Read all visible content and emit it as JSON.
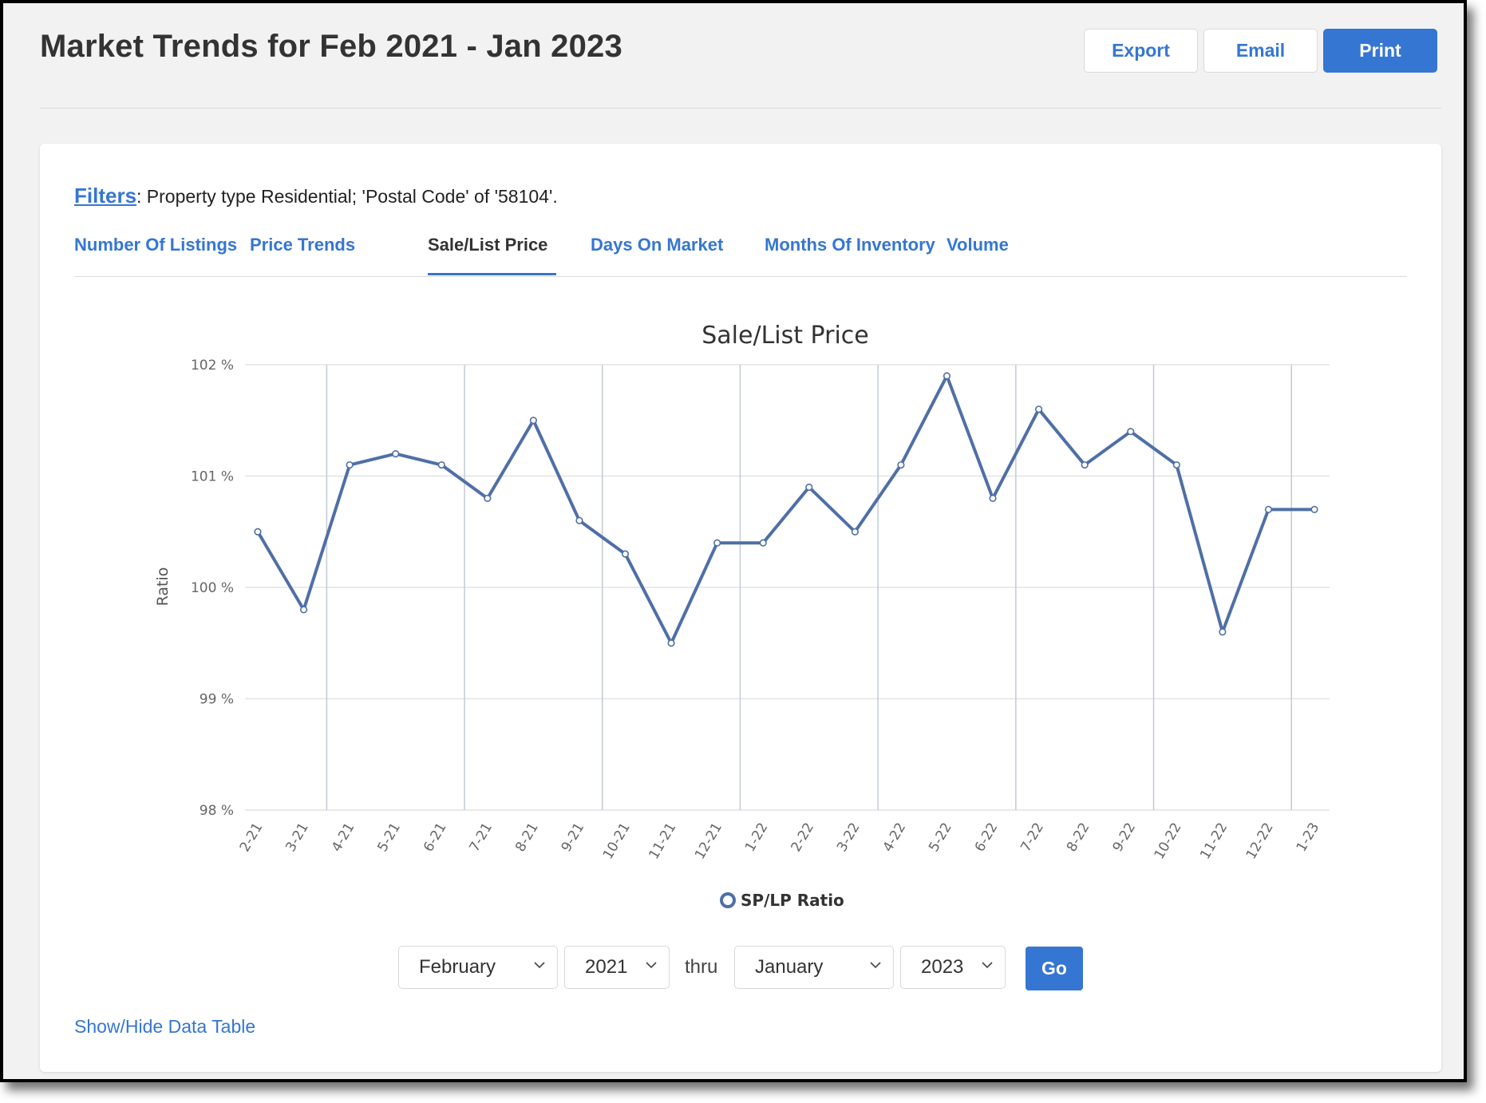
{
  "header": {
    "title": "Market Trends for Feb 2021 - Jan 2023",
    "buttons": {
      "export": "Export",
      "email": "Email",
      "print": "Print"
    }
  },
  "filters": {
    "link_label": "Filters",
    "text": ": Property type Residential; 'Postal Code' of '58104'."
  },
  "tabs": [
    {
      "label": "Number Of Listings",
      "active": false
    },
    {
      "label": "Price Trends",
      "active": false
    },
    {
      "label": "Sale/List Price",
      "active": true
    },
    {
      "label": "Days On Market",
      "active": false
    },
    {
      "label": "Months Of Inventory",
      "active": false
    },
    {
      "label": "Volume",
      "active": false
    }
  ],
  "colors": {
    "accent": "#3576d3",
    "series": "#4f6fa6",
    "grid": "#e3e3e3",
    "vgrid": "#c3cad6"
  },
  "chart_data": {
    "type": "line",
    "title": "Sale/List Price",
    "xlabel": "",
    "ylabel": "Ratio",
    "ylim": [
      98,
      102
    ],
    "yticks": [
      98,
      99,
      100,
      101,
      102
    ],
    "ytick_labels": [
      "98 %",
      "99 %",
      "100 %",
      "101 %",
      "102 %"
    ],
    "grid": true,
    "legend_position": "bottom",
    "categories": [
      "2-21",
      "3-21",
      "4-21",
      "5-21",
      "6-21",
      "7-21",
      "8-21",
      "9-21",
      "10-21",
      "11-21",
      "12-21",
      "1-22",
      "2-22",
      "3-22",
      "4-22",
      "5-22",
      "6-22",
      "7-22",
      "8-22",
      "9-22",
      "10-22",
      "11-22",
      "12-22",
      "1-23"
    ],
    "series": [
      {
        "name": "SP/LP Ratio",
        "values": [
          100.5,
          99.8,
          101.1,
          101.2,
          101.1,
          100.8,
          101.5,
          100.6,
          100.3,
          99.5,
          100.4,
          100.4,
          100.9,
          100.5,
          101.1,
          101.9,
          100.8,
          101.6,
          101.1,
          101.4,
          101.1,
          99.6,
          100.7,
          100.7
        ]
      }
    ]
  },
  "date_range": {
    "start_month": "February",
    "start_year": "2021",
    "separator": "thru",
    "end_month": "January",
    "end_year": "2023",
    "go_label": "Go"
  },
  "show_hide_label": "Show/Hide Data Table"
}
